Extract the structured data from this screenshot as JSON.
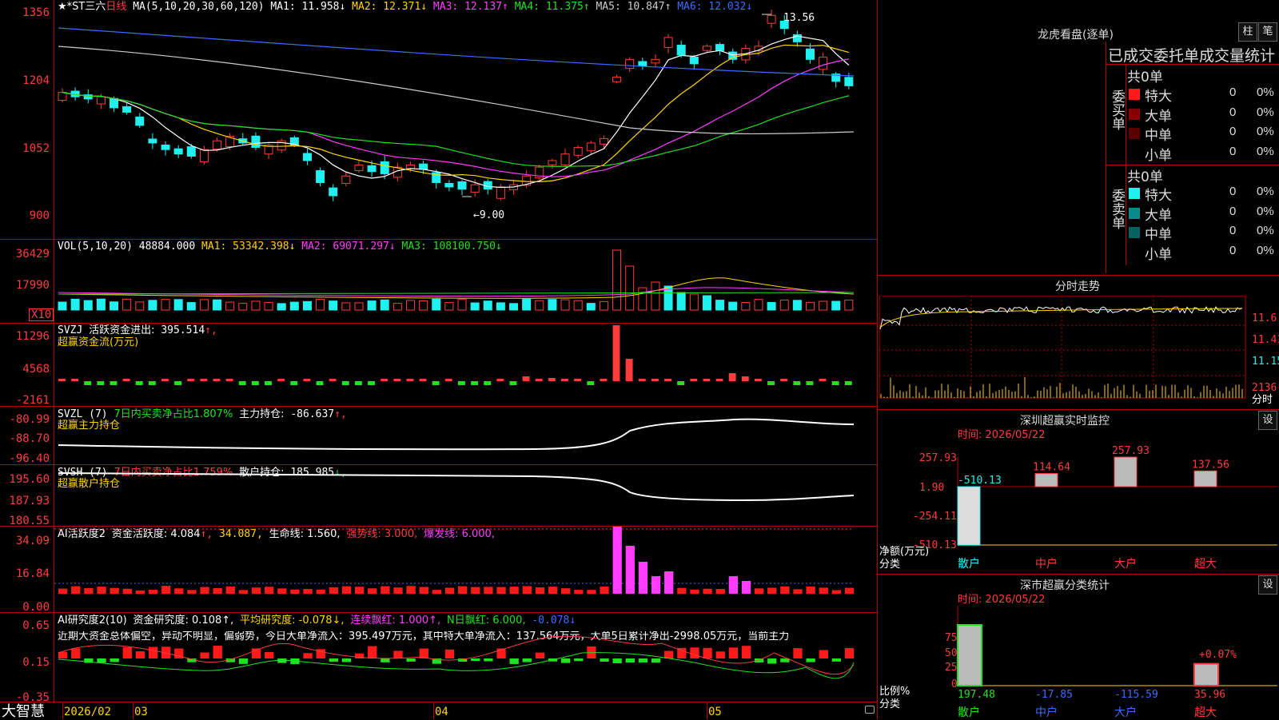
{
  "main": {
    "title": "★*ST三六",
    "period": "日线",
    "ma_label": "MA(5,10,20,30,60,120)",
    "ma": [
      {
        "name": "MA1:",
        "value": "11.958↓",
        "color": "#ffffff"
      },
      {
        "name": "MA2:",
        "value": "12.371↓",
        "color": "#ffd400"
      },
      {
        "name": "MA3:",
        "value": "12.137↑",
        "color": "#ff3cff"
      },
      {
        "name": "MA4:",
        "value": "11.375↑",
        "color": "#22e022"
      },
      {
        "name": "MA5:",
        "value": "10.847↑",
        "color": "#cccccc"
      },
      {
        "name": "MA6:",
        "value": "12.032↓",
        "color": "#3c6cff"
      }
    ],
    "y_ticks": [
      "1356",
      "1204",
      "1052",
      "900"
    ],
    "high_label": "13.56",
    "low_label": "←9.00"
  },
  "vol": {
    "label": "VOL(5,10,20)",
    "value": "48884.000",
    "ma": [
      {
        "name": "MA1:",
        "value": "53342.398↓",
        "color": "#ffd400"
      },
      {
        "name": "MA2:",
        "value": "69071.297↓",
        "color": "#ff3cff"
      },
      {
        "name": "MA3:",
        "value": "108100.750↓",
        "color": "#22e022"
      }
    ],
    "y_ticks": [
      "36429",
      "17990"
    ],
    "unit": "X10"
  },
  "svzj": {
    "label": "SVZJ",
    "line1": "活跃资金进出:",
    "value": "395.514",
    "arrow": "↑,",
    "line2": "超赢资金流(万元)",
    "y_ticks": [
      "11296",
      "4568",
      "-2161"
    ]
  },
  "svzl": {
    "label": "SVZL",
    "param": "(7)",
    "desc": "7日内买卖净占比1.807%",
    "hold_label": "主力持仓:",
    "hold_value": "-86.637",
    "arrow": "↑,",
    "line2": "超赢主力持仓",
    "y_ticks": [
      "-80.99",
      "-88.70",
      "-96.40"
    ]
  },
  "svsh": {
    "label": "SVSH",
    "param": "(7)",
    "desc": "7日内买卖净占比1.759%",
    "hold_label": "散户持仓:",
    "hold_value": "185.985",
    "arrow": "↓,",
    "line2": "超赢散户持仓",
    "y_ticks": [
      "195.60",
      "187.93",
      "180.55"
    ]
  },
  "ai1": {
    "label": "AI活跃度2",
    "a": "资金活跃度: 4.084",
    "b": "34.087,",
    "c": "生命线: 1.560,",
    "d": "强势线: 3.000,",
    "e": "爆发线: 6.000,",
    "y_ticks": [
      "34.09",
      "16.84",
      "0.00"
    ]
  },
  "ai2": {
    "label": "AI研究度2(10)",
    "a": "资金研究度: 0.108↑,",
    "b": "平均研究度: -0.078↓,",
    "c": "连续飘红: 1.000↑,",
    "d": "N日飘红: 6.000,",
    "e": "-0.078↓",
    "text": "近期大资金总体偏空，异动不明显，偏弱势，今日大单净流入：395.497万元，其中特大单净流入：137.564万元，大单5日累计净出-2998.05万元，当前主力",
    "y_ticks": [
      "0.65",
      "0.15",
      "-0.35"
    ]
  },
  "bottom": {
    "brand": "大智慧",
    "dates": [
      "2026/02",
      "03",
      "04",
      "05"
    ]
  },
  "right": {
    "title": "龙虎看盘(逐单)",
    "btn1": "柱",
    "btn2": "笔",
    "stat_title": "已成交委托单成交量统计",
    "buy_side": "委买单",
    "sell_side": "委卖单",
    "buy_total": "共0单",
    "sell_total": "共0单",
    "buy_rows": [
      {
        "name": "特大",
        "value": "0",
        "pct": "0%",
        "color": "#ff1a1a"
      },
      {
        "name": "大单",
        "value": "0",
        "pct": "0%",
        "color": "#8a0000"
      },
      {
        "name": "中单",
        "value": "0",
        "pct": "0%",
        "color": "#5a0000"
      },
      {
        "name": "小单",
        "value": "0",
        "pct": "0%",
        "color": "#000000"
      }
    ],
    "sell_rows": [
      {
        "name": "特大",
        "value": "0",
        "pct": "0%",
        "color": "#21f0f0"
      },
      {
        "name": "大单",
        "value": "0",
        "pct": "0%",
        "color": "#0a8a8a"
      },
      {
        "name": "中单",
        "value": "0",
        "pct": "0%",
        "color": "#056060"
      },
      {
        "name": "小单",
        "value": "0",
        "pct": "0%",
        "color": "#000000"
      }
    ],
    "intraday_title": "分时走势",
    "intraday_ticks": [
      "11.6",
      "11.41",
      "11.15",
      "2136",
      "分时"
    ],
    "sz_title": "深圳超赢实时监控",
    "sz_btn": "设",
    "sz_time": "时间: 2026/05/22",
    "sz_y": [
      "257.93",
      "1.90",
      "-254.11",
      "-510.13"
    ],
    "sz_ylabel1": "净额(万元)",
    "sz_ylabel2": "分类",
    "sz_bars": [
      {
        "cat": "散户",
        "value": "-510.13",
        "v": -510.13,
        "color": "#21f0f0"
      },
      {
        "cat": "中户",
        "value": "114.64",
        "v": 114.64,
        "color": "#ff3c3c"
      },
      {
        "cat": "大户",
        "value": "257.93",
        "v": 257.93,
        "color": "#ff3c3c"
      },
      {
        "cat": "超大",
        "value": "137.56",
        "v": 137.56,
        "color": "#ff3c3c"
      }
    ],
    "sm_title": "深市超赢分类统计",
    "sm_btn": "设",
    "sm_time": "时间: 2026/05/22",
    "sm_y": [
      "75",
      "50",
      "25",
      "0"
    ],
    "sm_ylabel1": "比例%",
    "sm_ylabel2": "分类",
    "sm_bar_label": "+0.07%",
    "sm_bars": [
      {
        "cat": "散户",
        "value": "197.48",
        "color": "#22e022",
        "h": 100
      },
      {
        "cat": "中户",
        "value": "-17.85",
        "color": "#3c6cff",
        "h": 0
      },
      {
        "cat": "大户",
        "value": "-115.59",
        "color": "#3c6cff",
        "h": 0
      },
      {
        "cat": "超大",
        "value": "35.96",
        "color": "#ff3c3c",
        "h": 36
      }
    ]
  }
}
